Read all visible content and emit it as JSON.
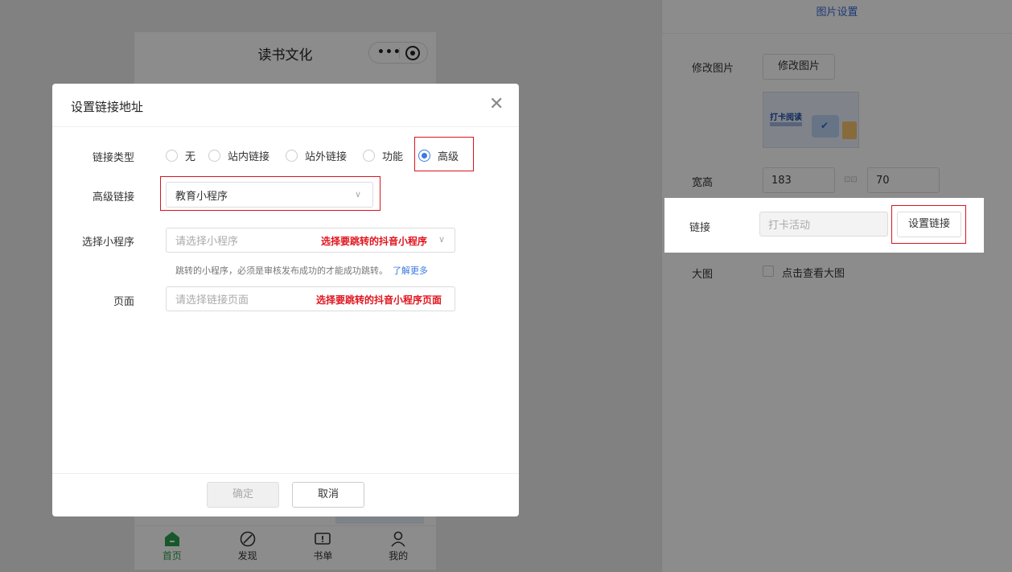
{
  "phone": {
    "title": "读书文化",
    "tabs": [
      {
        "label": "首页",
        "icon": "home-icon",
        "active": true
      },
      {
        "label": "发现",
        "icon": "compass-icon",
        "active": false
      },
      {
        "label": "书单",
        "icon": "booklist-icon",
        "active": false
      },
      {
        "label": "我的",
        "icon": "user-icon",
        "active": false
      }
    ]
  },
  "panel": {
    "header": "图片设置",
    "modify_image_label": "修改图片",
    "modify_image_button": "修改图片",
    "thumb_title": "打卡阅读",
    "size_label": "宽高",
    "width_value": "183",
    "height_value": "70",
    "link_label": "链接",
    "link_value": "打卡活动",
    "set_link_button": "设置链接",
    "big_image_label": "大图",
    "big_image_checkbox": "点击查看大图"
  },
  "modal": {
    "title": "设置链接地址",
    "link_type_label": "链接类型",
    "link_types": [
      {
        "label": "无",
        "selected": false
      },
      {
        "label": "站内链接",
        "selected": false
      },
      {
        "label": "站外链接",
        "selected": false
      },
      {
        "label": "功能",
        "selected": false
      },
      {
        "label": "高级",
        "selected": true
      }
    ],
    "advanced_link_label": "高级链接",
    "advanced_link_value": "教育小程序",
    "miniprogram_label": "选择小程序",
    "miniprogram_placeholder": "请选择小程序",
    "miniprogram_annotation": "选择要跳转的抖音小程序",
    "hint_text": "跳转的小程序，必须是审核发布成功的才能成功跳转。",
    "learn_more": "了解更多",
    "page_label": "页面",
    "page_placeholder": "请选择链接页面",
    "page_annotation": "选择要跳转的抖音小程序页面",
    "confirm_button": "确定",
    "cancel_button": "取消"
  },
  "colors": {
    "accent": "#3a7be0",
    "annotation_red": "#e0151e",
    "active_tab": "#2ba14d"
  }
}
